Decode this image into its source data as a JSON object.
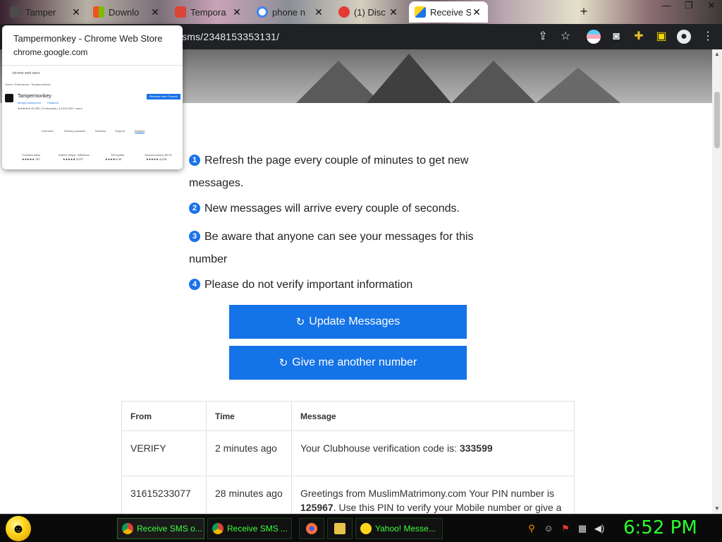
{
  "browser": {
    "tabs": [
      {
        "label": "Tamper",
        "color": "#4b4b4b"
      },
      {
        "label": "Downlo",
        "color": "#f25022"
      },
      {
        "label": "Tempora",
        "color": "#db4437"
      },
      {
        "label": "phone n",
        "color": "#ffffff"
      },
      {
        "label": "(1) Disc",
        "color": "#e53935"
      },
      {
        "label": "Receive S",
        "color": "#1a73e8"
      }
    ],
    "close_glyph": "✕",
    "new_tab_glyph": "+",
    "window_buttons": [
      "—",
      "❐",
      "✕"
    ],
    "address": "sms/2348153353131/"
  },
  "hover_card": {
    "title": "Tampermonkey - Chrome Web Store",
    "domain": "chrome.google.com",
    "thumb": {
      "store_label": "chrome web store",
      "breadcrumb": "Home › Extensions › Tampermonkey",
      "ext_name": "Tampermonkey",
      "ext_site": "tampermonkey.net",
      "featured": "Featured",
      "rating_line": "★★★★★ 49,996 | Productivity | 10,000,000+ users",
      "remove_btn": "Remove from Chrome",
      "nav": [
        "Overview",
        "Privacy practices",
        "Reviews",
        "Support",
        "Related"
      ],
      "related": [
        {
          "name": "Violentmonkey",
          "stars": "★★★★★ 747"
        },
        {
          "name": "Wikiful Helper: WikiEsca...",
          "stars": "★★★★★ 3,077"
        },
        {
          "name": "SEOquake",
          "stars": "★★★★½ 42"
        },
        {
          "name": "Tampermonkey BETA",
          "stars": "★★★★★ 4,076"
        }
      ]
    }
  },
  "page": {
    "instructions": [
      {
        "num": "1",
        "text": "Refresh the page every couple of minutes to get new messages."
      },
      {
        "num": "2",
        "text": "New messages will arrive every couple of seconds."
      },
      {
        "num": "3",
        "text": "Be aware that anyone can see your messages for this number"
      },
      {
        "num": "4",
        "text": "Please do not verify important information"
      }
    ],
    "buttons": {
      "refresh_glyph": "↻",
      "update": "Update Messages",
      "another": "Give me another number"
    },
    "table": {
      "headers": [
        "From",
        "Time",
        "Message"
      ],
      "rows": [
        {
          "from": "VERIFY",
          "time": "2 minutes ago",
          "message_prefix": "Your Clubhouse verification code is: ",
          "message_code": "333599",
          "message_suffix": ""
        },
        {
          "from": "31615233077",
          "time": "28 minutes ago",
          "message_prefix": "Greetings from MuslimMatrimony.com Your PIN number is ",
          "message_code": "125967",
          "message_suffix": ". Use this PIN to verify your Mobile number or give a"
        }
      ]
    }
  },
  "taskbar": {
    "items": [
      {
        "label": "Receive SMS o...",
        "color": "#1a73e8"
      },
      {
        "label": "Receive SMS ...",
        "color": "#1a73e8"
      },
      {
        "label": "Yahoo! Messe...",
        "color": "#ffd51c"
      }
    ],
    "clock": "6:52 PM"
  },
  "colors": {
    "accent": "#1473e6",
    "taskbar_text": "#3cff3c",
    "clock": "#2bff2b"
  }
}
